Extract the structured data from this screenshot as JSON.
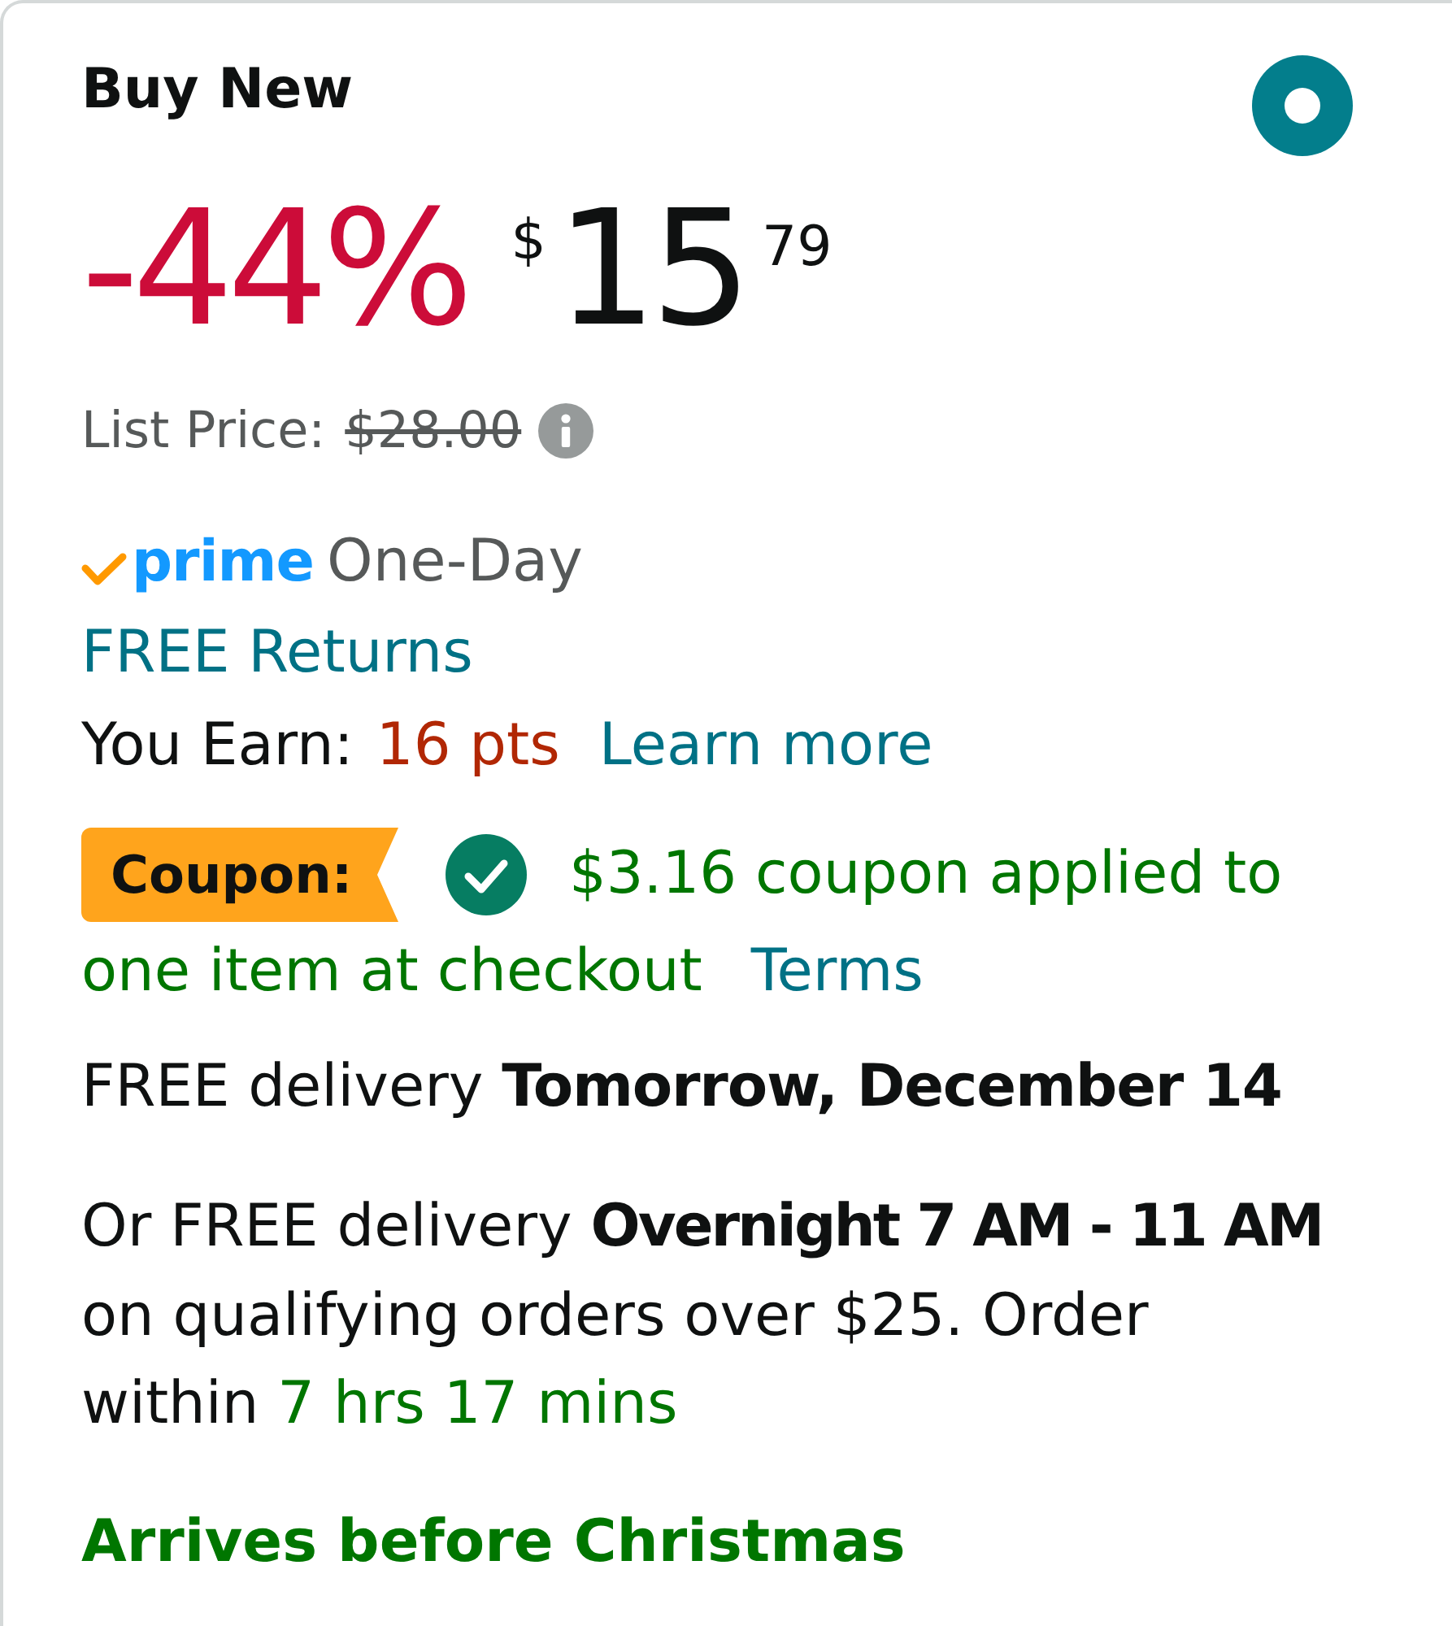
{
  "offer": {
    "title": "Buy New",
    "selected": true
  },
  "price": {
    "discount": "-44%",
    "currency": "$",
    "whole": "15",
    "fraction": "79"
  },
  "list_price": {
    "label": "List Price:",
    "value": "$28.00"
  },
  "prime": {
    "logo_text": "prime",
    "label": "One-Day"
  },
  "returns_link": "FREE Returns",
  "points": {
    "label": "You Earn:",
    "value": "16 pts",
    "link": "Learn more"
  },
  "coupon": {
    "badge": "Coupon:",
    "text_lines": [
      "$3.16 coupon applied to",
      "one item at checkout"
    ],
    "link": "Terms"
  },
  "delivery": {
    "primary": "FREE delivery **Tomorrow, December 14**",
    "alternative": "Or FREE delivery **Overnight 7 AM - 11 AM** on qualifying orders over $25. Order within",
    "countdown": "7 hrs 17 mins"
  },
  "holiday_note": "Arrives before Christmas"
}
